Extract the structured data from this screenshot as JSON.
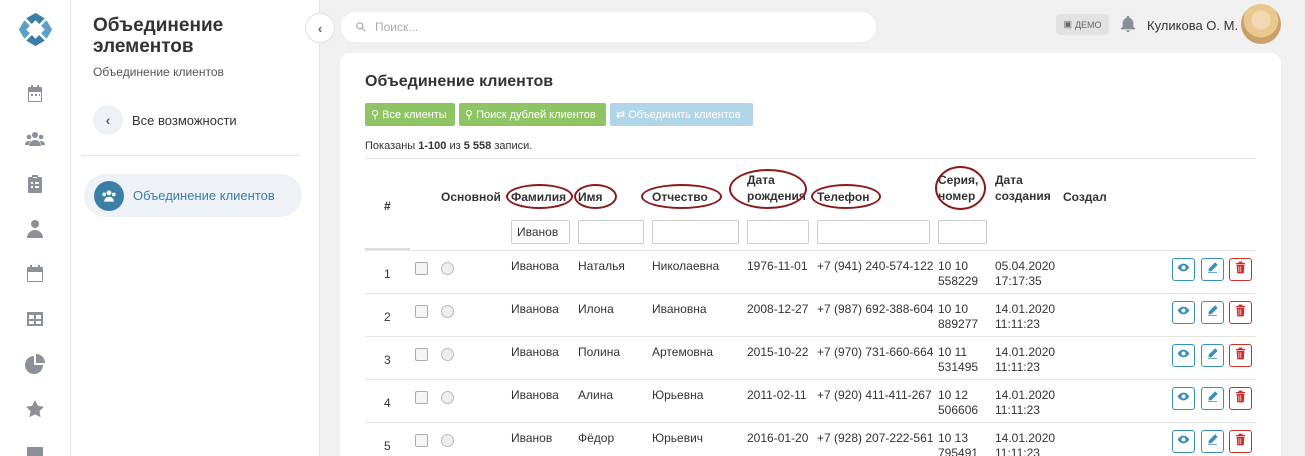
{
  "sidebar": {
    "title": "Объединение элементов",
    "subtitle": "Объединение клиентов",
    "back_label": "Все возможности",
    "active_item": "Объединение клиентов"
  },
  "rail_icons": [
    "calendar-icon",
    "users-icon",
    "clipboard-icon",
    "doctor-icon",
    "schedule-icon",
    "table-icon",
    "pie-chart-icon",
    "star-icon",
    "chat-icon"
  ],
  "header": {
    "search_placeholder": "Поиск...",
    "demo_badge": "ДЕМО",
    "user_name": "Куликова О. М."
  },
  "page": {
    "title": "Объединение клиентов",
    "buttons": {
      "all_clients": "Все клиенты",
      "find_duplicates": "Поиск дублей клиентов",
      "merge_clients": "Объединить клиентов"
    },
    "summary_prefix": "Показаны ",
    "summary_range": "1-100",
    "summary_mid": " из ",
    "summary_total": "5 558",
    "summary_suffix": " записи."
  },
  "table": {
    "columns": {
      "num": "#",
      "main": "Основной",
      "last_name": "Фамилия",
      "first_name": "Имя",
      "patronymic": "Отчество",
      "birth_date_1": "Дата",
      "birth_date_2": "рождения",
      "phone": "Телефон",
      "passport_1": "Серия,",
      "passport_2": "номер",
      "created_1": "Дата",
      "created_2": "создания",
      "author": "Создал"
    },
    "filters": {
      "last_name": "Иванов"
    },
    "rows": [
      {
        "num": "1",
        "last": "Иванова",
        "first": "Наталья",
        "patr": "Николаевна",
        "birth": "1976-11-01",
        "phone": "+7 (941) 240-574-122",
        "series": "10 10",
        "number": "558229",
        "date": "05.04.2020",
        "time": "17:17:35"
      },
      {
        "num": "2",
        "last": "Иванова",
        "first": "Илона",
        "patr": "Ивановна",
        "birth": "2008-12-27",
        "phone": "+7 (987) 692-388-604",
        "series": "10 10",
        "number": "889277",
        "date": "14.01.2020",
        "time": "11:11:23"
      },
      {
        "num": "3",
        "last": "Иванова",
        "first": "Полина",
        "patr": "Артемовна",
        "birth": "2015-10-22",
        "phone": "+7 (970) 731-660-664",
        "series": "10 11",
        "number": "531495",
        "date": "14.01.2020",
        "time": "11:11:23"
      },
      {
        "num": "4",
        "last": "Иванова",
        "first": "Алина",
        "patr": "Юрьевна",
        "birth": "2011-02-11",
        "phone": "+7 (920) 411-411-267",
        "series": "10 12",
        "number": "506606",
        "date": "14.01.2020",
        "time": "11:11:23"
      },
      {
        "num": "5",
        "last": "Иванов",
        "first": "Фёдор",
        "patr": "Юрьевич",
        "birth": "2016-01-20",
        "phone": "+7 (928) 207-222-561",
        "series": "10 13",
        "number": "795491",
        "date": "14.01.2020",
        "time": "11:11:23"
      }
    ]
  }
}
